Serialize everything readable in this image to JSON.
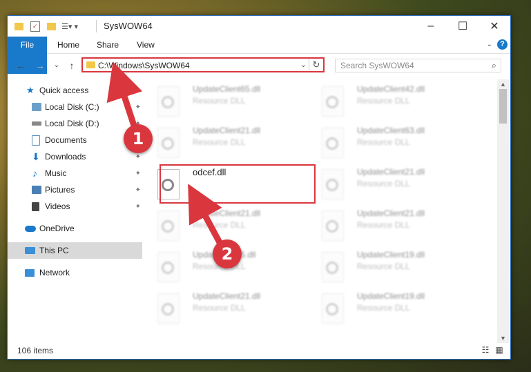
{
  "window": {
    "title": "SysWOW64",
    "controls": [
      "–",
      "☐",
      "✕"
    ]
  },
  "ribbon": {
    "tabs": [
      "File",
      "Home",
      "Share",
      "View"
    ],
    "help": "?"
  },
  "navbar": {
    "back": "←",
    "forward": "→",
    "recent": "⌄",
    "up": "↑",
    "address": "C:\\Windows\\SysWOW64",
    "dropdown": "⌄",
    "refresh": "↻",
    "search_placeholder": "Search SysWOW64",
    "search_icon": "⌕"
  },
  "sidebar": {
    "items": [
      {
        "label": "Quick access",
        "icon": "star-icon",
        "color": "#1979ca",
        "pinned": false
      },
      {
        "label": "Local Disk (C:)",
        "icon": "drive-icon",
        "color": "#6aa0c8",
        "pinned": true
      },
      {
        "label": "Local Disk (D:)",
        "icon": "drive-icon",
        "color": "#888888",
        "pinned": true
      },
      {
        "label": "Documents",
        "icon": "documents-icon",
        "color": "#5c8fc6",
        "pinned": true
      },
      {
        "label": "Downloads",
        "icon": "downloads-icon",
        "color": "#1979ca",
        "pinned": true
      },
      {
        "label": "Music",
        "icon": "music-icon",
        "color": "#1979ca",
        "pinned": true
      },
      {
        "label": "Pictures",
        "icon": "pictures-icon",
        "color": "#4a7fb5",
        "pinned": true
      },
      {
        "label": "Videos",
        "icon": "videos-icon",
        "color": "#444444",
        "pinned": true
      },
      {
        "label": "OneDrive",
        "icon": "cloud-icon",
        "color": "#1979ca",
        "pinned": false
      },
      {
        "label": "This PC",
        "icon": "computer-icon",
        "color": "#3a8fd6",
        "pinned": false
      },
      {
        "label": "Network",
        "icon": "network-icon",
        "color": "#3a8fd6",
        "pinned": false
      }
    ],
    "pin_glyph": "📌"
  },
  "files": {
    "left": [
      {
        "name": "UpdateClient65.dll",
        "type": "Resource DLL"
      },
      {
        "name": "UpdateClient21.dll",
        "type": "Resource DLL"
      },
      {
        "name": "odcef.dll",
        "type": ""
      },
      {
        "name": "UpdateClient21.dll",
        "type": "Resource DLL"
      },
      {
        "name": "UpdateClient5.dll",
        "type": "Resource DLL"
      },
      {
        "name": "UpdateClient21.dll",
        "type": "Resource DLL"
      }
    ],
    "right": [
      {
        "name": "UpdateClient42.dll",
        "type": "Resource DLL"
      },
      {
        "name": "UpdateClient63.dll",
        "type": "Resource DLL"
      },
      {
        "name": "UpdateClient21.dll",
        "type": "Resource DLL"
      },
      {
        "name": "UpdateClient21.dll",
        "type": "Resource DLL"
      },
      {
        "name": "UpdateClient19.dll",
        "type": "Resource DLL"
      },
      {
        "name": "UpdateClient19.dll",
        "type": "Resource DLL"
      }
    ]
  },
  "status": {
    "count": "106 items",
    "details_view": "☷",
    "tiles_view": "▦"
  },
  "annotations": {
    "step1": "1",
    "step2": "2",
    "color": "#d9363e"
  }
}
